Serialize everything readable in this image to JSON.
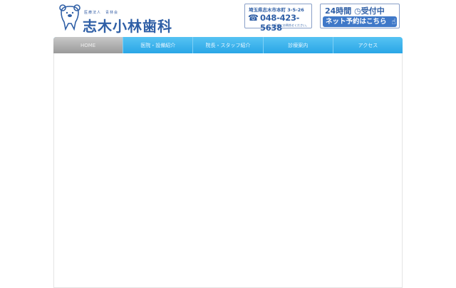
{
  "logo": {
    "subtitle": "医療法人　青林会",
    "name": "志木小林歯科"
  },
  "address": {
    "text": "埼玉県志木市本町 3-5-26",
    "phone": "048-423-5638",
    "note": "お気軽にお問合せください。"
  },
  "booking": {
    "top": "24時間",
    "top2": "受付中",
    "button": "ネット予約はこちら"
  },
  "nav": {
    "items": [
      {
        "label": "HOME"
      },
      {
        "label": "医院・設備紹介"
      },
      {
        "label": "院長・スタッフ紹介"
      },
      {
        "label": "診療案内"
      },
      {
        "label": "アクセス"
      }
    ]
  }
}
